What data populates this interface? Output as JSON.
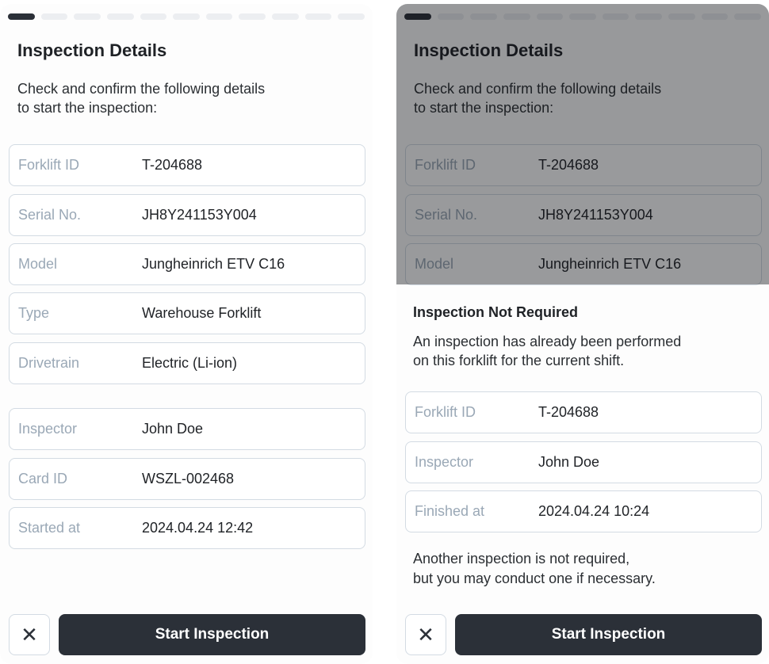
{
  "left": {
    "title": "Inspection Details",
    "subtitle_line1": "Check and confirm the following details",
    "subtitle_line2": "to start the inspection:",
    "fields": [
      {
        "label": "Forklift ID",
        "value": "T-204688"
      },
      {
        "label": "Serial No.",
        "value": "JH8Y241153Y004"
      },
      {
        "label": "Model",
        "value": "Jungheinrich ETV C16"
      },
      {
        "label": "Type",
        "value": "Warehouse Forklift"
      },
      {
        "label": "Drivetrain",
        "value": "Electric (Li-ion)"
      },
      {
        "label": "Inspector",
        "value": "John Doe"
      },
      {
        "label": "Card ID",
        "value": "WSZL-002468"
      },
      {
        "label": "Started at",
        "value": "2024.04.24 12:42"
      }
    ],
    "close_label": "✕",
    "start_label": "Start Inspection"
  },
  "right": {
    "title": "Inspection Details",
    "subtitle_line1": "Check and confirm the following details",
    "subtitle_line2": "to start the inspection:",
    "bg_fields": [
      {
        "label": "Forklift ID",
        "value": "T-204688"
      },
      {
        "label": "Serial No.",
        "value": "JH8Y241153Y004"
      },
      {
        "label": "Model",
        "value": "Jungheinrich ETV C16"
      }
    ],
    "modal": {
      "title": "Inspection Not Required",
      "text_line1": "An inspection has already been performed",
      "text_line2": "on this forklift for the current shift.",
      "fields": [
        {
          "label": "Forklift ID",
          "value": "T-204688"
        },
        {
          "label": "Inspector",
          "value": "John Doe"
        },
        {
          "label": "Finished at",
          "value": "2024.04.24 10:24"
        }
      ],
      "note_line1": "Another inspection is not required,",
      "note_line2": "but you may conduct one if necessary."
    },
    "close_label": "✕",
    "start_label": "Start Inspection"
  },
  "progress": {
    "total_steps": 11,
    "current_step": 1
  },
  "colors": {
    "primary": "#2b3038",
    "border": "#d3dbe3",
    "label": "#9aa8b6"
  }
}
